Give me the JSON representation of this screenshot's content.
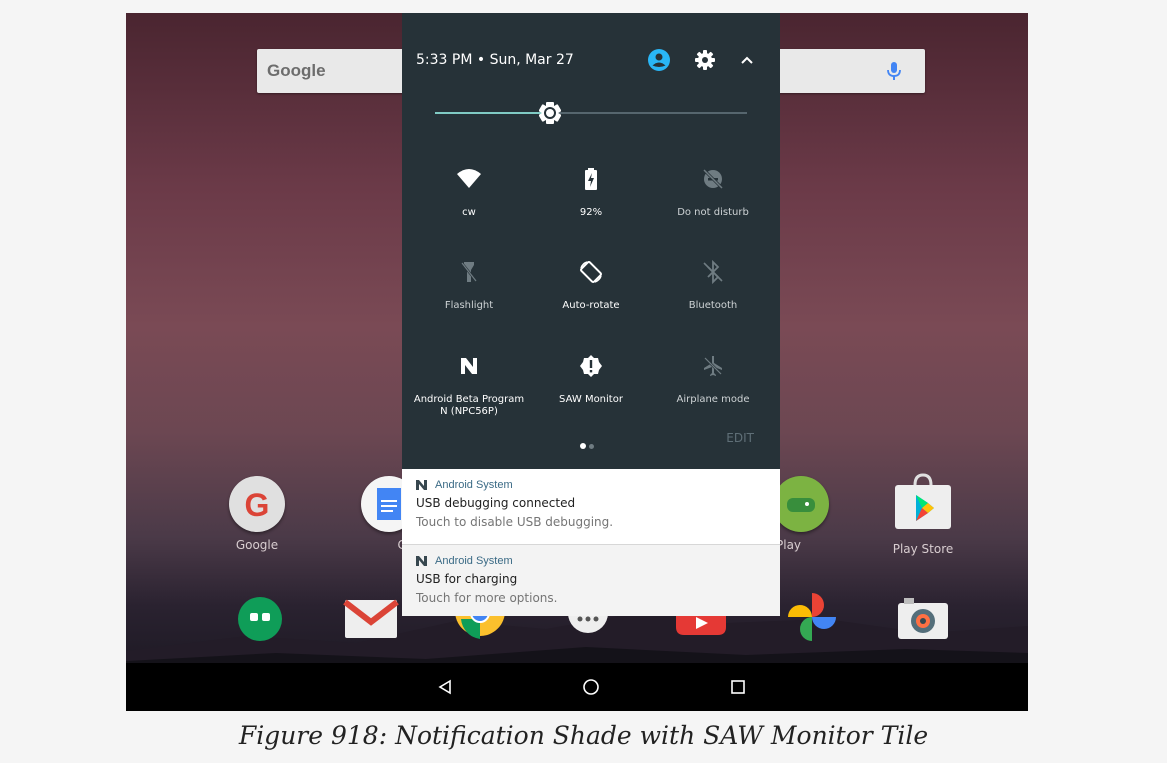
{
  "search_bar": {
    "logo": "Google",
    "mic_icon": "mic-icon"
  },
  "home_apps": [
    {
      "label": "Google",
      "color": "#e0e0e0"
    },
    {
      "label": "Creat",
      "color": "#f5f5f5"
    },
    {
      "label": "Play",
      "color": "#7cb342"
    },
    {
      "label": "Play Store",
      "color": "#ffffff"
    }
  ],
  "status_header": {
    "time_date": "5:33 PM • Sun, Mar 27",
    "icons": [
      "account-icon",
      "gear-icon",
      "chevron-up-icon"
    ],
    "accent_color": "#29b6f6"
  },
  "brightness": {
    "level": 0.37
  },
  "tiles": [
    {
      "label": "cw",
      "icon": "wifi-icon",
      "active": true
    },
    {
      "label": "92%",
      "icon": "battery-charging-icon",
      "active": true
    },
    {
      "label": "Do not disturb",
      "icon": "do-not-disturb-icon",
      "active": false
    },
    {
      "label": "Flashlight",
      "icon": "flashlight-icon",
      "active": false
    },
    {
      "label": "Auto-rotate",
      "icon": "auto-rotate-icon",
      "active": true
    },
    {
      "label": "Bluetooth",
      "icon": "bluetooth-off-icon",
      "active": false
    },
    {
      "label": "Android Beta Program",
      "label2": "N (NPC56P)",
      "icon": "android-n-icon",
      "active": true
    },
    {
      "label": "SAW Monitor",
      "icon": "saw-monitor-icon",
      "active": true
    },
    {
      "label": "Airplane mode",
      "icon": "airplane-icon",
      "active": false
    }
  ],
  "pager": {
    "pages": 2,
    "current": 1
  },
  "edit_label": "EDIT",
  "notifications": [
    {
      "app": "Android System",
      "title": "USB debugging connected",
      "text": "Touch to disable USB debugging."
    },
    {
      "app": "Android System",
      "title": "USB for charging",
      "text": "Touch for more options."
    }
  ],
  "nav": [
    "back-icon",
    "home-icon",
    "recents-icon"
  ],
  "caption": "Figure 918: Notification Shade with SAW Monitor Tile"
}
